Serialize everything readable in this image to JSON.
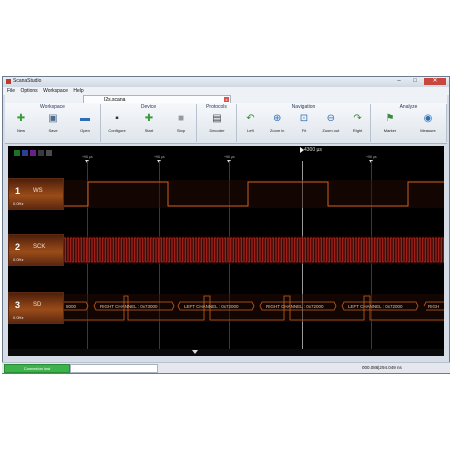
{
  "window": {
    "title": "ScanaStudio",
    "min": "–",
    "max": "□",
    "close": "✕"
  },
  "menu": [
    "File",
    "Options",
    "Workspace",
    "Help"
  ],
  "document_tab": {
    "label": "I2s.scana",
    "close": "x"
  },
  "toolbar": {
    "groups": [
      {
        "title": "Workspace",
        "buttons": [
          {
            "label": "New",
            "icon": "plus-icon",
            "glyph": "✚",
            "color": "#3a9a3a"
          },
          {
            "label": "Save",
            "icon": "save-icon",
            "glyph": "▣",
            "color": "#4f6b8c"
          },
          {
            "label": "Open",
            "icon": "folder-icon",
            "glyph": "▬",
            "color": "#2e6fb3"
          }
        ]
      },
      {
        "title": "Device",
        "buttons": [
          {
            "label": "Configure",
            "icon": "device-icon",
            "glyph": "▪",
            "color": "#333333"
          },
          {
            "label": "Start",
            "icon": "start-icon",
            "glyph": "✚",
            "color": "#3a9a3a"
          },
          {
            "label": "Stop",
            "icon": "stop-icon",
            "glyph": "■",
            "color": "#999999"
          }
        ]
      },
      {
        "title": "Protocols",
        "buttons": [
          {
            "label": "Decoder",
            "icon": "decoder-icon",
            "glyph": "▤",
            "color": "#444444"
          }
        ]
      },
      {
        "title": "Navigation",
        "buttons": [
          {
            "label": "Left",
            "icon": "left-arrow-icon",
            "glyph": "↶",
            "color": "#3a8a3a"
          },
          {
            "label": "Zoom in",
            "icon": "zoom-in-icon",
            "glyph": "⊕",
            "color": "#2e6fb3"
          },
          {
            "label": "Fit",
            "icon": "fit-icon",
            "glyph": "⊡",
            "color": "#2e6fb3"
          },
          {
            "label": "Zoom out",
            "icon": "zoom-out-icon",
            "glyph": "⊖",
            "color": "#2e6fb3"
          },
          {
            "label": "Right",
            "icon": "right-arrow-icon",
            "glyph": "↷",
            "color": "#3a8a3a"
          }
        ]
      },
      {
        "title": "Analyze",
        "buttons": [
          {
            "label": "Marker",
            "icon": "marker-icon",
            "glyph": "⚑",
            "color": "#3a8a3a"
          },
          {
            "label": "Measure",
            "icon": "measure-icon",
            "glyph": "◉",
            "color": "#2e6fb3"
          }
        ]
      }
    ]
  },
  "color_squares": [
    "#1e6f2a",
    "#2a3f8f",
    "#6a1f8f",
    "#3a3a3a",
    "#4a4a4a"
  ],
  "time_ticks": [
    "+96 µs",
    "+96 µs",
    "+96 µs",
    "+96 µs"
  ],
  "cursor_time": "4300 µs",
  "channels": [
    {
      "number": "1",
      "name": "WS",
      "sub": "0.0Hz",
      "color": "#c8601e"
    },
    {
      "number": "2",
      "name": "SCK",
      "sub": "0.0Hz",
      "color": "#c0281e"
    },
    {
      "number": "3",
      "name": "SD",
      "sub": "0.0Hz",
      "color": "#c8601e"
    }
  ],
  "decoded_frames": [
    "8000",
    "RIGHT CHANNEL : 0x73000",
    "LEFT CHANNEL : 0x72000",
    "RIGHT CHANNEL : 0x72000",
    "LEFT CHANNEL : 0x72000",
    "RIGH"
  ],
  "status": {
    "connection": "Connexion lost",
    "time": "000.086|294.049 ns"
  }
}
